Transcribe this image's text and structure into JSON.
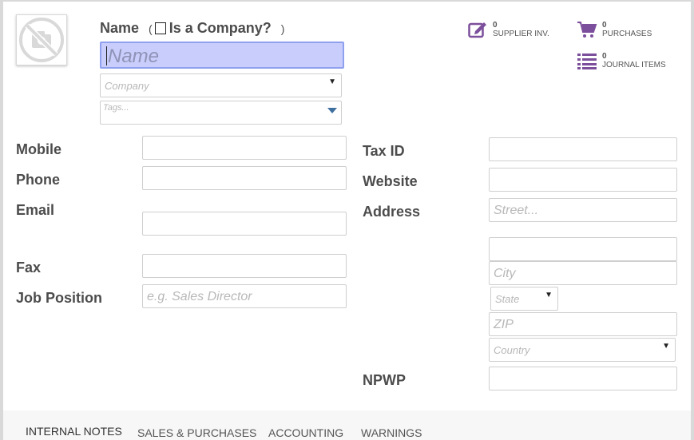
{
  "header": {
    "name_label": "Name",
    "paren_open": "(",
    "paren_close": ")",
    "is_company_label": "Is a Company?",
    "name_placeholder": "Name",
    "company_placeholder": "Company",
    "tags_placeholder": "Tags..."
  },
  "stat_buttons": [
    {
      "count": "0",
      "label": "SUPPLIER INV.",
      "icon": "edit-icon"
    },
    {
      "count": "0",
      "label": "PURCHASES",
      "icon": "cart-icon"
    },
    {
      "count": "0",
      "label": "JOURNAL ITEMS",
      "icon": "list-icon"
    }
  ],
  "left_fields": {
    "mobile_label": "Mobile",
    "phone_label": "Phone",
    "email_label": "Email",
    "fax_label": "Fax",
    "job_position_label": "Job Position",
    "job_position_placeholder": "e.g. Sales Director"
  },
  "right_fields": {
    "tax_id_label": "Tax ID",
    "website_label": "Website",
    "address_label": "Address",
    "street_placeholder": "Street...",
    "city_placeholder": "City",
    "state_placeholder": "State",
    "zip_placeholder": "ZIP",
    "country_placeholder": "Country",
    "npwp_label": "NPWP"
  },
  "tabs": [
    "INTERNAL NOTES",
    "SALES & PURCHASES",
    "ACCOUNTING",
    "WARNINGS"
  ],
  "colors": {
    "accent_purple": "#7c4f9c",
    "focus_background": "#c9cdfb",
    "focus_border": "#8ea0ee"
  }
}
